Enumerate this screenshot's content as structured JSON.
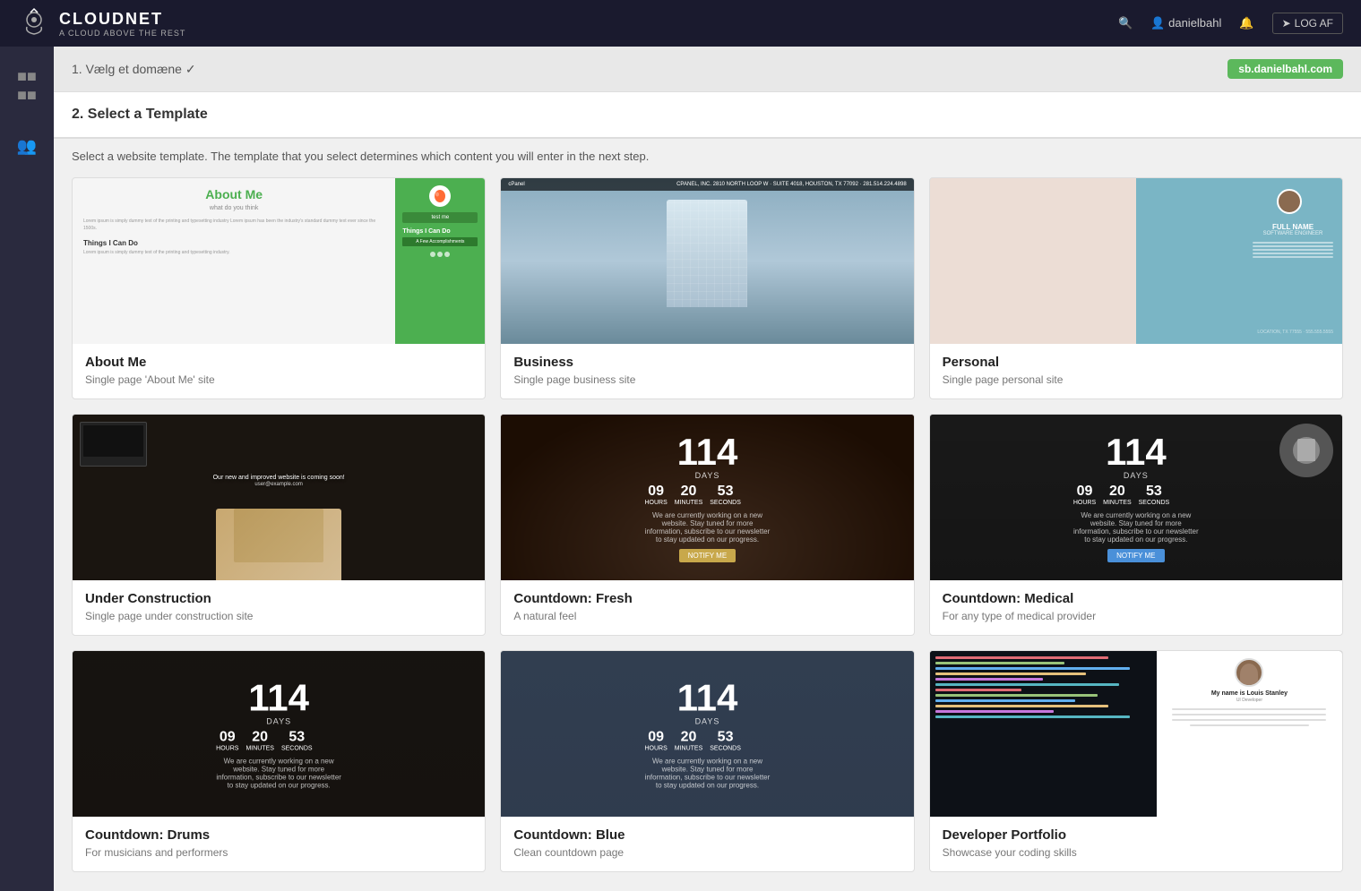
{
  "nav": {
    "logo_title": "CLOUDNET",
    "logo_subtitle": "A CLOUD ABOVE THE REST",
    "user": "danielbahl",
    "logout_label": "LOG AF"
  },
  "step1": {
    "label": "1. Vælg et domæne ✓",
    "badge": "sb.danielbahl.com"
  },
  "step2": {
    "label": "2. Select a Template",
    "description": "Select a website template. The template that you select determines which content you will enter in the next step."
  },
  "templates": [
    {
      "id": "about-me",
      "name": "About Me",
      "description": "Single page 'About Me' site",
      "preview_type": "about"
    },
    {
      "id": "business",
      "name": "Business",
      "description": "Single page business site",
      "preview_type": "business"
    },
    {
      "id": "personal",
      "name": "Personal",
      "description": "Single page personal site",
      "preview_type": "personal"
    },
    {
      "id": "under-construction",
      "name": "Under Construction",
      "description": "Single page under construction site",
      "preview_type": "construction"
    },
    {
      "id": "countdown-fresh",
      "name": "Countdown: Fresh",
      "description": "A natural feel",
      "preview_type": "countdown-fresh"
    },
    {
      "id": "countdown-medical",
      "name": "Countdown: Medical",
      "description": "For any type of medical provider",
      "preview_type": "countdown-medical"
    },
    {
      "id": "countdown-drums",
      "name": "Countdown: Drums",
      "description": "For musicians and performers",
      "preview_type": "countdown-drums"
    },
    {
      "id": "countdown-blue",
      "name": "Countdown: Blue",
      "description": "Clean countdown page",
      "preview_type": "countdown-blue"
    },
    {
      "id": "dev-portfolio",
      "name": "Developer Portfolio",
      "description": "Showcase your coding skills",
      "preview_type": "dev"
    }
  ],
  "countdown": {
    "days": "114",
    "days_label": "DAYS",
    "hours": "09",
    "minutes": "20",
    "seconds": "53",
    "subtitle": "We are currently working on a new website. Stay tuned for more information, subscribe to our newsletter to stay updated on our progress.",
    "notify_label": "NOTIFY ME"
  }
}
